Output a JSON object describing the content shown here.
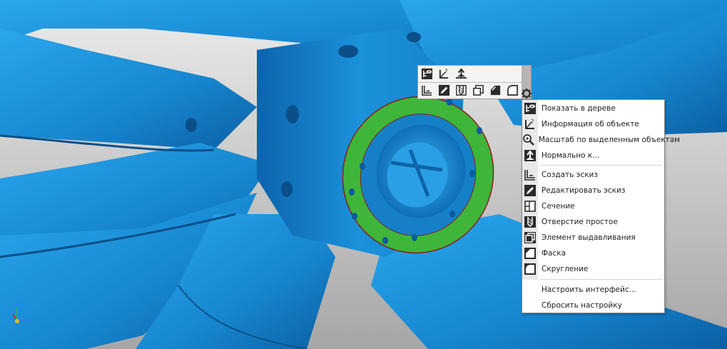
{
  "mini_toolbar": {
    "row1": [
      {
        "icon": "show-in-tree-icon"
      },
      {
        "icon": "object-info-icon"
      },
      {
        "icon": "normal-to-icon"
      }
    ],
    "row2": [
      {
        "icon": "create-sketch-icon"
      },
      {
        "icon": "edit-sketch-icon"
      },
      {
        "icon": "simple-hole-icon"
      },
      {
        "icon": "extrude-icon"
      },
      {
        "icon": "chamfer-icon"
      },
      {
        "icon": "fillet-icon"
      }
    ],
    "settings_icon": "gear-icon"
  },
  "context_menu": {
    "items": [
      {
        "label": "Показать в дереве",
        "icon": "show-in-tree-icon"
      },
      {
        "label": "Информация об объекте",
        "icon": "object-info-icon"
      },
      {
        "label": "Масштаб по выделенным объектам",
        "icon": "zoom-to-selection-icon"
      },
      {
        "label": "Нормально к...",
        "icon": "normal-to-icon"
      },
      {
        "label": "Создать эскиз",
        "icon": "create-sketch-icon"
      },
      {
        "label": "Редактировать эскиз",
        "icon": "edit-sketch-icon"
      },
      {
        "label": "Сечение",
        "icon": "section-icon"
      },
      {
        "label": "Отверстие простое",
        "icon": "simple-hole-icon"
      },
      {
        "label": "Элемент выдавливания",
        "icon": "extrude-icon"
      },
      {
        "label": "Фаска",
        "icon": "chamfer-icon"
      },
      {
        "label": "Скругление",
        "icon": "fillet-icon"
      },
      {
        "label": "Настроить интерфейс..."
      },
      {
        "label": "Сбросить настройку"
      }
    ]
  },
  "colors": {
    "model": "#1a8fd6",
    "selected_face": "#3fb53a",
    "background_top": "#e6e6e6",
    "background_bottom": "#a9a9a9",
    "menu_icon_dark": "#2b2b2b"
  }
}
